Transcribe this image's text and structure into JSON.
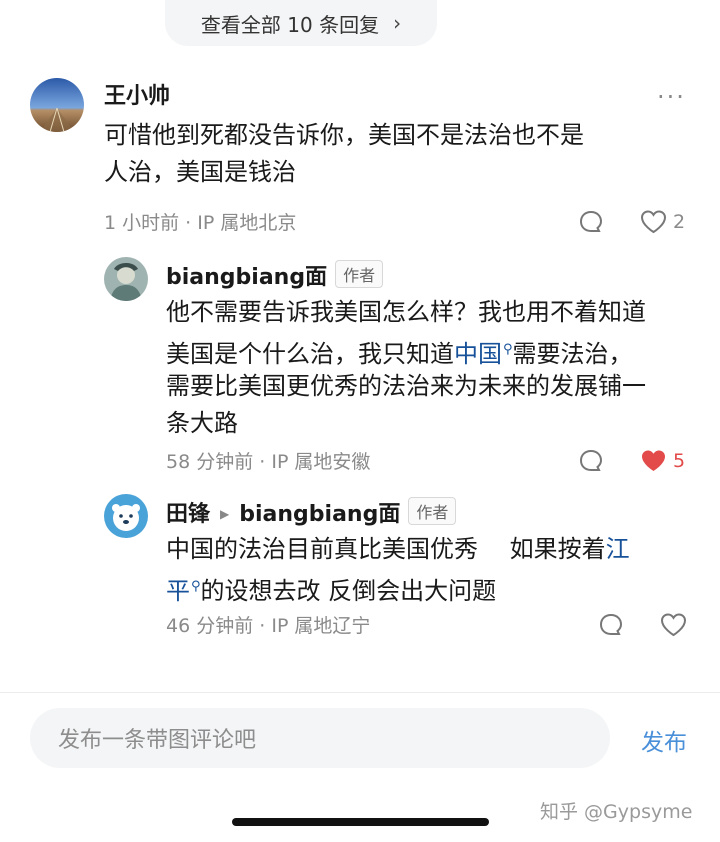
{
  "view_all": {
    "label": "查看全部 10 条回复",
    "chevron": "›"
  },
  "comments": [
    {
      "author": "王小帅",
      "lines": [
        "可惜他到死都没告诉你，美国不是法治也不是",
        "人治，美国是钱治"
      ],
      "meta": "1 小时前 · IP 属地北京",
      "likes": "2",
      "more": "···"
    },
    {
      "author": "biangbiang面",
      "tag": "作者",
      "line1": "他不需要告诉我美国怎么样？我也用不着知道",
      "line2_pre": "美国是个什么治，我只知道",
      "line2_link": "中国",
      "line2_post": "需要法治，",
      "line3": "需要比美国更优秀的法治来为未来的发展铺一",
      "line4": "条大路",
      "meta": "58 分钟前 · IP 属地安徽",
      "likes": "5"
    },
    {
      "author": "田锋",
      "reply_to": "biangbiang面",
      "tag": "作者",
      "line1_pre": "中国的法治目前真比美国优秀　 如果按着",
      "line1_link": "江",
      "line2_link": "平",
      "line2_post": "的设想去改 反倒会出大问题",
      "meta": "46 分钟前 · IP 属地辽宁"
    }
  ],
  "composer": {
    "placeholder": "发布一条带图评论吧",
    "publish": "发布"
  },
  "watermark": "知乎 @Gypsyme",
  "colors": {
    "link": "#175199",
    "liked": "#e34a4a",
    "publish": "#4a90d9"
  }
}
